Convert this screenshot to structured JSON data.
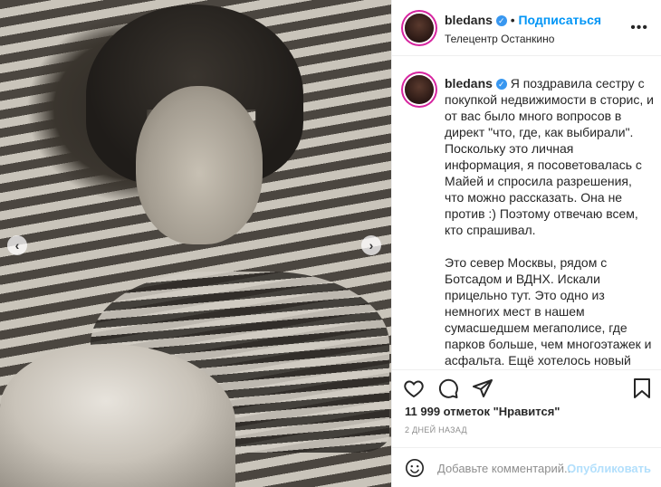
{
  "post": {
    "username": "bledans",
    "follow_label": "Подписаться",
    "separator": "•",
    "location": "Телецентр Останкино",
    "more": "•••"
  },
  "caption": {
    "username": "bledans",
    "text": "Я поздравила сестру с покупкой недвижимости в сторис, и от вас было много вопросов в директ \"что, где, как выбирали\". Поскольку это личная информация, я посоветовалась с Майей и спросила разрешения, что можно рассказать. Она не против :) Поэтому отвечаю всем, кто спрашивал.\n\nЭто север Москвы, рядом с Ботсадом и ВДНХ. Искали прицельно тут. Это одно из немногих мест в нашем сумасшедшем мегаполисе, где парков больше, чем многоэтажек и асфальта. Ещё хотелось новый современный дом с приличными соседями и потолки повыше."
  },
  "carousel": {
    "prev": "‹",
    "next": "›",
    "active_index": 2,
    "count": 6
  },
  "stats": {
    "likes": "11 999 отметок \"Нравится\"",
    "time": "2 ДНЕЙ НАЗАД"
  },
  "comment": {
    "placeholder": "Добавьте комментарий...",
    "post_label": "Опубликовать"
  },
  "icons": {
    "like": "heart-icon",
    "comment": "comment-icon",
    "share": "share-icon",
    "save": "bookmark-icon",
    "emoji": "emoji-icon",
    "verified": "verified-badge-icon"
  },
  "colors": {
    "accent": "#0095f6",
    "post_disabled": "#b2dffc",
    "muted": "#8e8e8e"
  }
}
